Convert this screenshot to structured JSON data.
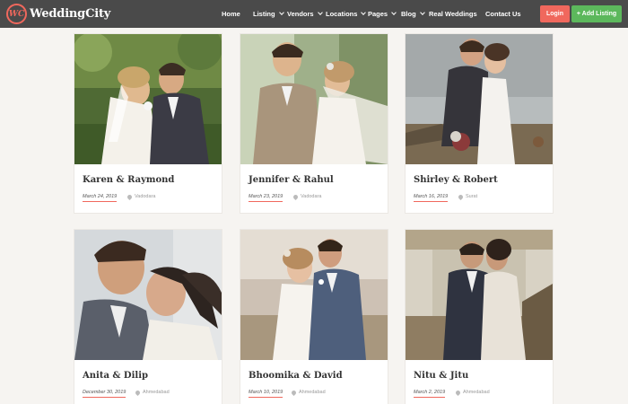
{
  "header": {
    "logo_badge": "WC",
    "logo_text": "WeddingCity",
    "nav": [
      {
        "label": "Home"
      },
      {
        "label": "Listing"
      },
      {
        "label": "Vendors"
      },
      {
        "label": "Locations"
      },
      {
        "label": "Pages"
      },
      {
        "label": "Blog"
      },
      {
        "label": "Real Weddings"
      },
      {
        "label": "Contact Us"
      }
    ],
    "login_label": "Login",
    "add_listing_label": "+ Add Listing"
  },
  "cards": [
    {
      "title": "Karen & Raymond",
      "date": "March 24, 2019",
      "location": "Vadodara"
    },
    {
      "title": "Jennifer & Rahul",
      "date": "March 23, 2019",
      "location": "Vadodara"
    },
    {
      "title": "Shirley & Robert",
      "date": "March 16, 2019",
      "location": "Surat"
    },
    {
      "title": "Anita & Dilip",
      "date": "December 30, 2019",
      "location": "Ahmedabad"
    },
    {
      "title": "Bhoomika & David",
      "date": "March 10, 2019",
      "location": "Ahmedabad"
    },
    {
      "title": "Nitu & Jitu",
      "date": "March 2, 2019",
      "location": "Ahmedabad"
    }
  ],
  "colors": {
    "header_bg": "#4a4a4a",
    "accent": "#f0685d",
    "add_button": "#5cb85c",
    "page_bg": "#f6f4f1"
  }
}
